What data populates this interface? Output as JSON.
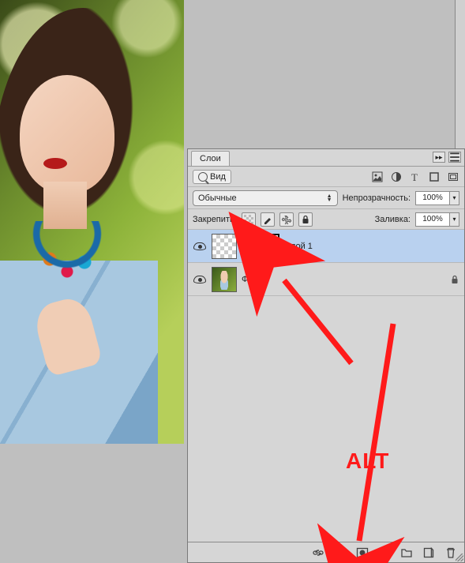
{
  "panel": {
    "tab_label": "Слои",
    "search_label": "Вид",
    "blend_mode": "Обычные",
    "opacity_label": "Непрозрачность:",
    "opacity_value": "100%",
    "lock_label": "Закрепить:",
    "fill_label": "Заливка:",
    "fill_value": "100%",
    "layers": [
      {
        "name": "Слой 1",
        "selected": true,
        "has_mask": true
      },
      {
        "name": "Фон",
        "selected": false,
        "locked": true
      }
    ]
  },
  "annotation": {
    "label": "ALT"
  }
}
